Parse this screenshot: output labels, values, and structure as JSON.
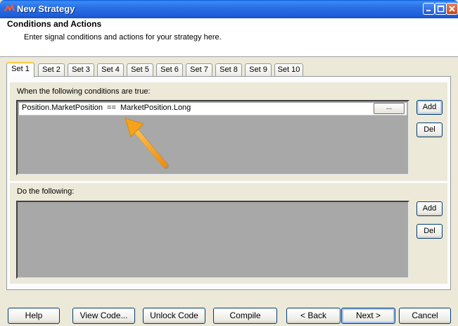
{
  "window": {
    "title": "New Strategy"
  },
  "header": {
    "title": "Conditions and Actions",
    "subtitle": "Enter signal conditions and actions for your strategy here."
  },
  "tabs": [
    "Set 1",
    "Set 2",
    "Set 3",
    "Set 4",
    "Set 5",
    "Set 6",
    "Set 7",
    "Set 8",
    "Set 9",
    "Set 10"
  ],
  "active_tab": "Set 1",
  "conditions": {
    "label": "When the following conditions are true:",
    "items": [
      {
        "text": "Position.MarketPosition  ==  MarketPosition.Long",
        "button": "..."
      }
    ],
    "add_label": "Add",
    "del_label": "Del"
  },
  "actions": {
    "label": "Do the following:",
    "items": [],
    "add_label": "Add",
    "del_label": "Del"
  },
  "footer": {
    "help": "Help",
    "view_code": "View Code...",
    "unlock_code": "Unlock Code",
    "compile": "Compile",
    "back": "< Back",
    "next": "Next >",
    "cancel": "Cancel"
  },
  "colors": {
    "titlebar": "#245edb",
    "accent_arrow": "#f5a623",
    "list_bg": "#a8a8a8"
  },
  "icons": {
    "app": "ninjatrader-logo-icon",
    "annotation": "orange-arrow-icon"
  }
}
